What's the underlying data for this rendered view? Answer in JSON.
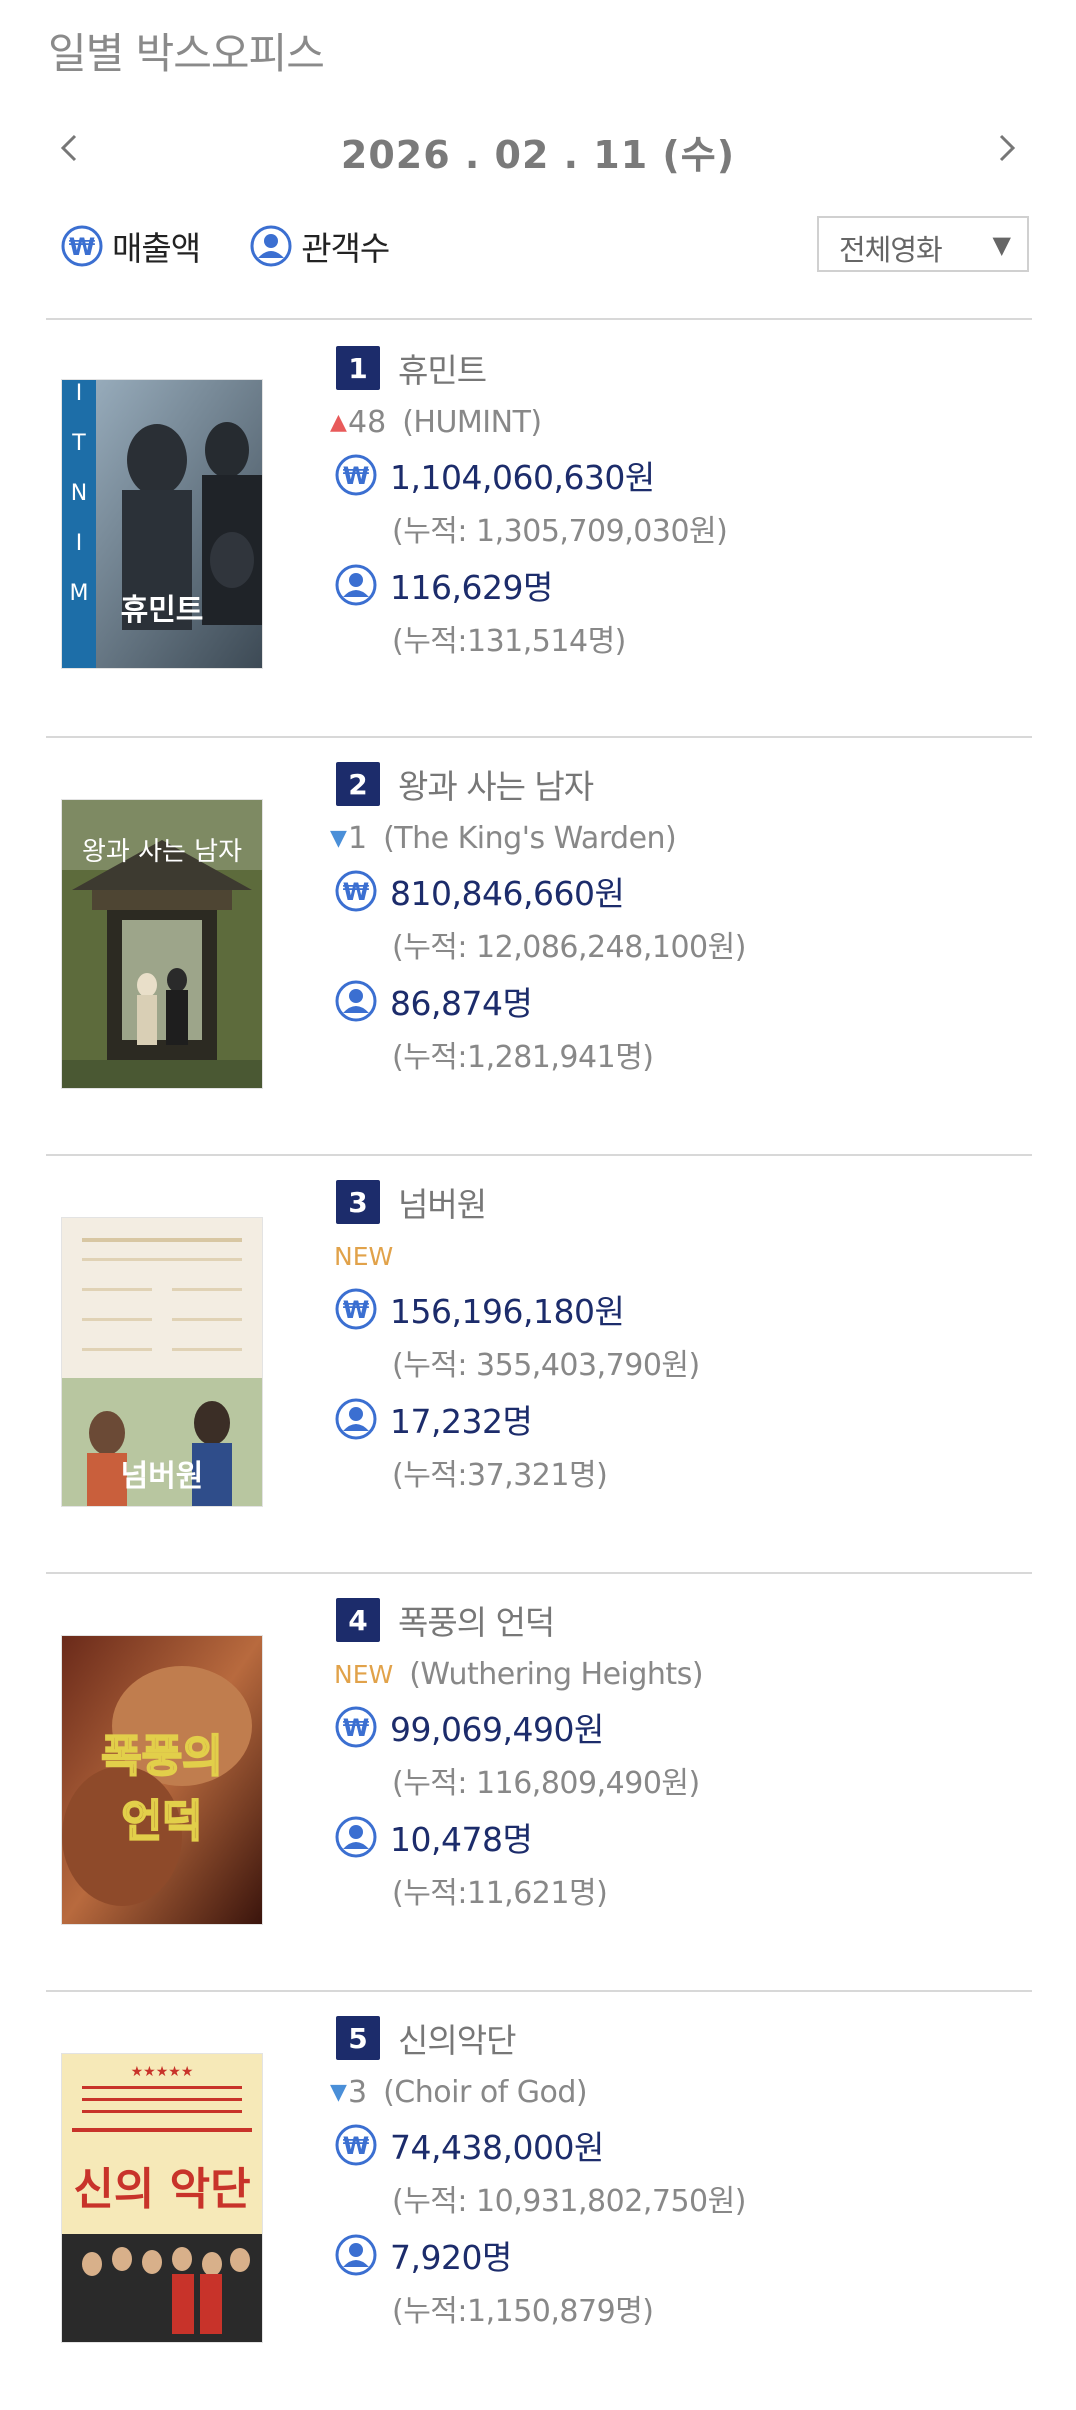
{
  "page": {
    "title": "일별 박스오피스"
  },
  "date_nav": {
    "date": "2026 . 02 . 11  (수)"
  },
  "legend": {
    "sales_label": "매출액",
    "audience_label": "관객수"
  },
  "filter": {
    "selected": "전체영화"
  },
  "colors": {
    "navy": "#1c2c6b",
    "icon_blue": "#3b6fd1",
    "up": "#e85a5a",
    "down": "#4a8fd8",
    "new": "#e1a24a"
  },
  "movies": [
    {
      "rank": "1",
      "title": "휴민트",
      "change_dir": "up",
      "change": "48",
      "change_arrow": "▲",
      "is_new": "",
      "english": "(HUMINT)",
      "sales": "1,104,060,630원",
      "sales_cum": "(누적: 1,305,709,030원)",
      "audience": "116,629명",
      "audience_cum": "(누적:131,514명)",
      "poster_text": "휴민트"
    },
    {
      "rank": "2",
      "title": "왕과 사는 남자",
      "change_dir": "down",
      "change": "1",
      "change_arrow": "▼",
      "is_new": "",
      "english": "(The King's Warden)",
      "sales": "810,846,660원",
      "sales_cum": "(누적: 12,086,248,100원)",
      "audience": "86,874명",
      "audience_cum": "(누적:1,281,941명)",
      "poster_text": "왕과 사는 남자"
    },
    {
      "rank": "3",
      "title": "넘버원",
      "change_dir": "new",
      "change": "",
      "change_arrow": "",
      "is_new": "NEW",
      "english": "",
      "sales": "156,196,180원",
      "sales_cum": "(누적: 355,403,790원)",
      "audience": "17,232명",
      "audience_cum": "(누적:37,321명)",
      "poster_text": "넘버원"
    },
    {
      "rank": "4",
      "title": "폭풍의 언덕",
      "change_dir": "new",
      "change": "",
      "change_arrow": "",
      "is_new": "NEW",
      "english": "(Wuthering Heights)",
      "sales": "99,069,490원",
      "sales_cum": "(누적: 116,809,490원)",
      "audience": "10,478명",
      "audience_cum": "(누적:11,621명)",
      "poster_text": "폭풍의 언덕"
    },
    {
      "rank": "5",
      "title": "신의악단",
      "change_dir": "down",
      "change": "3",
      "change_arrow": "▼",
      "is_new": "",
      "english": "(Choir of God)",
      "sales": "74,438,000원",
      "sales_cum": "(누적: 10,931,802,750원)",
      "audience": "7,920명",
      "audience_cum": "(누적:1,150,879명)",
      "poster_text": "신의 악단"
    }
  ]
}
